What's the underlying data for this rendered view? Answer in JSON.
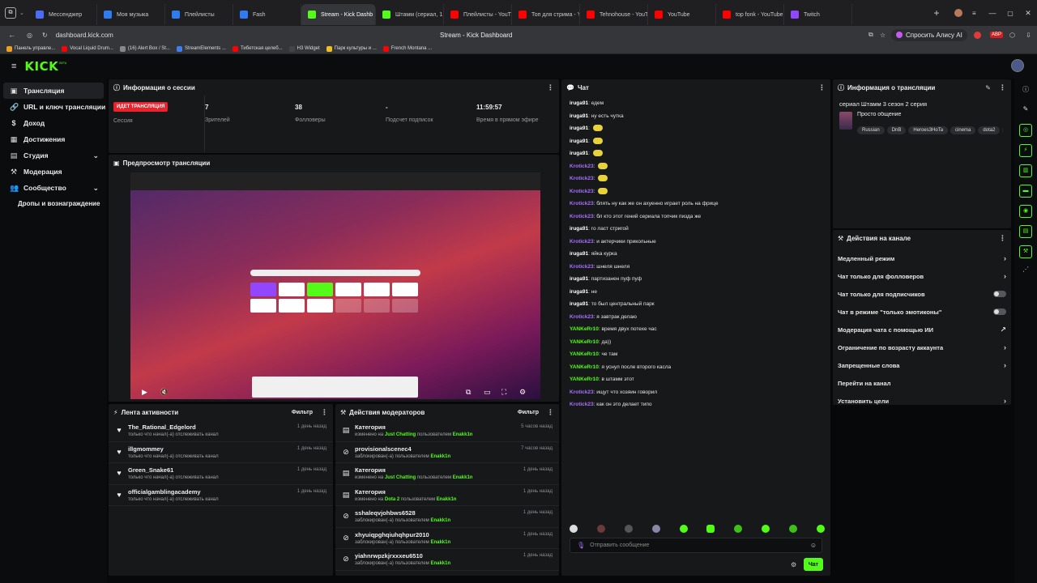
{
  "browser": {
    "tabs": [
      {
        "label": "Мессенджер",
        "color": "#4a6cf7",
        "active": false
      },
      {
        "label": "Моя музыка",
        "color": "#2f7bf0",
        "active": false
      },
      {
        "label": "Плейлисты",
        "color": "#2f7bf0",
        "active": false
      },
      {
        "label": "Fash",
        "color": "#2f7bf0",
        "active": false
      },
      {
        "label": "Stream - Kick Dashb",
        "color": "#53fc18",
        "active": true
      },
      {
        "label": "Штамм (сериал, 1, 2, 3",
        "color": "#53fc18",
        "active": false
      },
      {
        "label": "Плейлисты - YouTube",
        "color": "#ff0000",
        "active": false
      },
      {
        "label": "Топ для стрима - YouTu",
        "color": "#ff0000",
        "active": false
      },
      {
        "label": "Tehnohouse - YouTube",
        "color": "#ff0000",
        "active": false
      },
      {
        "label": "YouTube",
        "color": "#ff0000",
        "active": false
      },
      {
        "label": "top fonk - YouTube",
        "color": "#ff0000",
        "active": false
      },
      {
        "label": "Twitch",
        "color": "#9146ff",
        "active": false
      }
    ],
    "url": "dashboard.kick.com",
    "page_title": "Stream - Kick Dashboard",
    "alice_label": "Спросить Алису AI",
    "bookmarks": [
      {
        "label": "Панель управле...",
        "color": "#f0a020"
      },
      {
        "label": "Vocal Liquid Drum...",
        "color": "#ff0000"
      },
      {
        "label": "(16) Alert Box / St...",
        "color": "#888888"
      },
      {
        "label": "StreamElements ...",
        "color": "#3d7ff0"
      },
      {
        "label": "Тибетская целеб...",
        "color": "#ff0000"
      },
      {
        "label": "H3 Widget",
        "color": "#444444"
      },
      {
        "label": "Парк культуры и ...",
        "color": "#f0c020"
      },
      {
        "label": "French Montana ...",
        "color": "#ff0000"
      }
    ]
  },
  "kick": {
    "logo": "KICK",
    "beta": "BETA"
  },
  "sidebar": {
    "items": [
      {
        "label": "Трансляция",
        "icon": "▣"
      },
      {
        "label": "URL и ключ трансляции",
        "icon": "🔗"
      },
      {
        "label": "Доход",
        "icon": "$"
      },
      {
        "label": "Достижения",
        "icon": "▦"
      },
      {
        "label": "Студия",
        "icon": "▤"
      },
      {
        "label": "Модерация",
        "icon": "⚒"
      },
      {
        "label": "Сообщество",
        "icon": "👥"
      }
    ],
    "sub_item": "Дропы и вознаграждение"
  },
  "session": {
    "title": "Информация о сессии",
    "live_badge": "ИДЕТ ТРАНСЛЯЦИЯ",
    "session_label": "Сессия",
    "viewers": "7",
    "viewers_label": "Зрителей",
    "followers": "38",
    "followers_label": "Фолловеры",
    "subs": "-",
    "subs_label": "Подсчет подписок",
    "uptime": "11:59:57",
    "uptime_label": "Время в прямом эфире"
  },
  "preview": {
    "title": "Предпросмотр трансляции"
  },
  "activity": {
    "title": "Лента активности",
    "filter": "Фильтр",
    "items": [
      {
        "name": "The_Rational_Edgelord",
        "sub": "только что начал(-а) отслеживать канал",
        "time": "1 день назад"
      },
      {
        "name": "illgmommey",
        "sub": "только что начал(-а) отслеживать канал",
        "time": "1 день назад"
      },
      {
        "name": "Green_Snake61",
        "sub": "только что начал(-а) отслеживать канал",
        "time": "1 день назад"
      },
      {
        "name": "officialgamblingacademy",
        "sub": "только что начал(-а) отслеживать канал",
        "time": "1 день назад"
      }
    ]
  },
  "modactions": {
    "title": "Действия модераторов",
    "filter": "Фильтр",
    "items": [
      {
        "name": "Категория",
        "pre": "изменено на",
        "target": "Just Chatting",
        "mid": "пользователем",
        "user": "Enakk1n",
        "time": "5 часов назад",
        "icon": "category"
      },
      {
        "name": "provisionalscenec4",
        "pre": "заблокирован(-а) пользователем",
        "target": "",
        "mid": "",
        "user": "Enakk1n",
        "time": "7 часов назад",
        "icon": "ban"
      },
      {
        "name": "Категория",
        "pre": "изменено на",
        "target": "Just Chatting",
        "mid": "пользователем",
        "user": "Enakk1n",
        "time": "1 день назад",
        "icon": "category"
      },
      {
        "name": "Категория",
        "pre": "изменено на",
        "target": "Dota 2",
        "mid": "пользователем",
        "user": "Enakk1n",
        "time": "1 день назад",
        "icon": "category"
      },
      {
        "name": "sshaleqvjohbws6528",
        "pre": "заблокирован(-а) пользователем",
        "target": "",
        "mid": "",
        "user": "Enakk1n",
        "time": "1 день назад",
        "icon": "ban"
      },
      {
        "name": "xhyuiqpghqiuhqhpur2010",
        "pre": "заблокирован(-а) пользователем",
        "target": "",
        "mid": "",
        "user": "Enakk1n",
        "time": "1 день назад",
        "icon": "ban"
      },
      {
        "name": "yiahnrwpzkjrxxxeu6510",
        "pre": "заблокирован(-а) пользователем",
        "target": "",
        "mid": "",
        "user": "Enakk1n",
        "time": "1 день назад",
        "icon": "ban"
      }
    ]
  },
  "chat": {
    "title": "Чат",
    "messages": [
      {
        "user": "iruga91",
        "color": "#ffffff",
        "text": "едем",
        "emote": false
      },
      {
        "user": "iruga91",
        "color": "#ffffff",
        "text": "ну есть чутка",
        "emote": false
      },
      {
        "user": "iruga91",
        "color": "#ffffff",
        "text": "",
        "emote": true
      },
      {
        "user": "iruga91",
        "color": "#ffffff",
        "text": "",
        "emote": true
      },
      {
        "user": "iruga91",
        "color": "#ffffff",
        "text": "",
        "emote": true
      },
      {
        "user": "Krotick23",
        "color": "#a970ff",
        "text": "",
        "emote": true
      },
      {
        "user": "Krotick23",
        "color": "#a970ff",
        "text": "",
        "emote": true
      },
      {
        "user": "Krotick23",
        "color": "#a970ff",
        "text": "",
        "emote": true
      },
      {
        "user": "Krotick23",
        "color": "#a970ff",
        "text": "блять ну как же он ахуенно играет роль на фрице",
        "emote": false
      },
      {
        "user": "Krotick23",
        "color": "#a970ff",
        "text": "бл кто этот гений сериала топчик пизда же",
        "emote": false
      },
      {
        "user": "iruga91",
        "color": "#ffffff",
        "text": "го ласт стригой",
        "emote": false
      },
      {
        "user": "Krotick23",
        "color": "#a970ff",
        "text": "и актерчики прикольные",
        "emote": false
      },
      {
        "user": "iruga91",
        "color": "#ffffff",
        "text": "яйка курка",
        "emote": false
      },
      {
        "user": "Krotick23",
        "color": "#a970ff",
        "text": "шнеля шнеля",
        "emote": false
      },
      {
        "user": "iruga91",
        "color": "#ffffff",
        "text": "партизанен пуф пуф",
        "emote": false
      },
      {
        "user": "iruga91",
        "color": "#ffffff",
        "text": "не",
        "emote": false
      },
      {
        "user": "iruga91",
        "color": "#ffffff",
        "text": "то был центральный парк",
        "emote": false
      },
      {
        "user": "Krotick23",
        "color": "#a970ff",
        "text": "я завтрак делаю",
        "emote": false
      },
      {
        "user": "YANKeRr10",
        "color": "#53fc18",
        "text": "время двух потехе час",
        "emote": false
      },
      {
        "user": "YANKeRr10",
        "color": "#53fc18",
        "text": "да))",
        "emote": false
      },
      {
        "user": "YANKeRr10",
        "color": "#53fc18",
        "text": "че там",
        "emote": false
      },
      {
        "user": "YANKeRr10",
        "color": "#53fc18",
        "text": "я уснул после второго касла",
        "emote": false
      },
      {
        "user": "YANKeRr10",
        "color": "#53fc18",
        "text": "в штамм этот",
        "emote": false
      },
      {
        "user": "Krotick23",
        "color": "#a970ff",
        "text": "ищут что хозяин говорил",
        "emote": false
      },
      {
        "user": "Krotick23",
        "color": "#a970ff",
        "text": "как он это делает типо",
        "emote": false
      }
    ],
    "placeholder": "Отправить сообщение",
    "send": "Чат"
  },
  "streaminfo": {
    "title": "Информация о трансляции",
    "stream_title": "сериал Штамм 3 сезон 2 серия",
    "category": "Просто общение",
    "tags": [
      "Russian",
      "DnB",
      "Heroes3HoTa",
      "cinema",
      "dota2",
      "fon"
    ]
  },
  "channel_actions": {
    "title": "Действия на канале",
    "items": [
      {
        "label": "Медленный режим",
        "control": "arrow"
      },
      {
        "label": "Чат только для фолловеров",
        "control": "arrow"
      },
      {
        "label": "Чат только для подписчиков",
        "control": "toggle"
      },
      {
        "label": "Чат в режиме \"только эмотиконы\"",
        "control": "toggle"
      },
      {
        "label": "Модерация чата с помощью ИИ",
        "control": "external"
      },
      {
        "label": "Ограничение по возрасту аккаунта",
        "control": "arrow"
      },
      {
        "label": "Запрещенные слова",
        "control": "arrow"
      },
      {
        "label": "Перейти на канал",
        "control": "none"
      },
      {
        "label": "Установить цели",
        "control": "arrow"
      }
    ]
  }
}
